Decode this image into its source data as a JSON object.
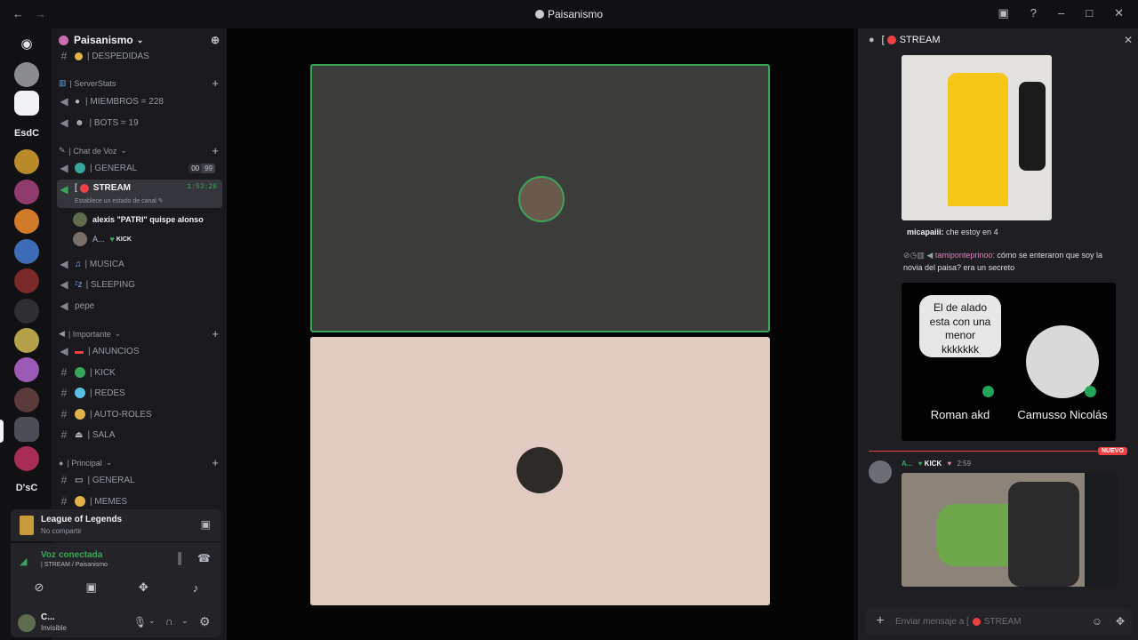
{
  "window": {
    "title": "Paisanismo"
  },
  "guilds": {
    "label_esdc": "EsdC",
    "label_dsc": "D'sC"
  },
  "server": {
    "name": "Paisanismo"
  },
  "channels": {
    "despedidas": "| DESPEDIDAS",
    "cat_serverstats": "| ServerStats",
    "miembros": "| MIEMBROS = 228",
    "bots": "| BOTS = 19",
    "cat_voz": "| Chat de Voz",
    "general_voice": "| GENERAL",
    "general_badge_left": "00",
    "general_badge_right": "99",
    "stream_name": "STREAM",
    "stream_prefix": "[",
    "stream_time": "1:53:26",
    "stream_status": "Establece un estado de canal",
    "user1": "alexis \"PATRI\" quispe alonso",
    "user2": "A...",
    "user2_tag": "KICK",
    "musica": "| MUSICA",
    "sleeping": "| SLEEPING",
    "pepe": "pepe",
    "cat_importante": "| Importante",
    "anuncios": "| ANUNCIOS",
    "kick": "| KICK",
    "redes": "| REDES",
    "autoroles": "| AUTO-ROLES",
    "sala": "| SALA",
    "cat_principal": "| Principal",
    "general_text": "| GENERAL",
    "memes": "| MEMES"
  },
  "activity": {
    "game": "League of Legends",
    "share_status": "No compartir"
  },
  "voice": {
    "status": "Voz conectada",
    "channel": "| STREAM / Paisanismo"
  },
  "user": {
    "name": "C...",
    "status": "Invisible"
  },
  "chat": {
    "prefix": "[",
    "channel": "STREAM",
    "msg1_author": "micapaiii:",
    "msg1_text": "che estoy en 4",
    "msg2_author": "tamiponteprinoo:",
    "msg2_text": "cómo se enteraron que soy la novia del paisa? era un secreto",
    "card_bubble": "El de alado esta con una menor kkkkkkk",
    "card_name1": "Roman akd",
    "card_name2": "Camusso Nicolás",
    "new_label": "NUEVO",
    "msg3_author": "A...",
    "msg3_tag": "KICK",
    "msg3_time": "2:59",
    "composer_placeholder": "Enviar mensaje a [",
    "composer_channel": "STREAM"
  },
  "colors": {
    "accent_green": "#3ba55c",
    "live_red": "#ed4245",
    "new_red": "#f23f43",
    "stage_bg": "#050505"
  }
}
